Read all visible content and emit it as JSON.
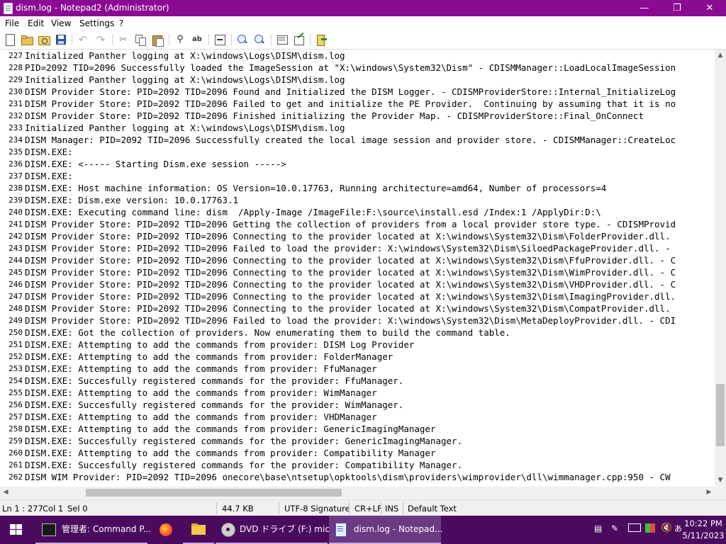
{
  "window": {
    "title": "dism.log - Notepad2 (Administrator)",
    "minimize": "—",
    "maximize": "❐",
    "close": "✕"
  },
  "menu": [
    "File",
    "Edit",
    "View",
    "Settings",
    "?"
  ],
  "editor": {
    "lines": [
      {
        "n": "227",
        "t": "Initialized Panther logging at X:\\windows\\Logs\\DISM\\dism.log"
      },
      {
        "n": "228",
        "t": "PID=2092 TID=2096 Successfully loaded the ImageSession at \"X:\\windows\\System32\\Dism\" - CDISMManager::LoadLocalImageSession"
      },
      {
        "n": "229",
        "t": "Initialized Panther logging at X:\\windows\\Logs\\DISM\\dism.log"
      },
      {
        "n": "230",
        "t": "DISM Provider Store: PID=2092 TID=2096 Found and Initialized the DISM Logger. - CDISMProviderStore::Internal_InitializeLog"
      },
      {
        "n": "231",
        "t": "DISM Provider Store: PID=2092 TID=2096 Failed to get and initialize the PE Provider.  Continuing by assuming that it is no"
      },
      {
        "n": "232",
        "t": "DISM Provider Store: PID=2092 TID=2096 Finished initializing the Provider Map. - CDISMProviderStore::Final_OnConnect"
      },
      {
        "n": "233",
        "t": "Initialized Panther logging at X:\\windows\\Logs\\DISM\\dism.log"
      },
      {
        "n": "234",
        "t": "DISM Manager: PID=2092 TID=2096 Successfully created the local image session and provider store. - CDISMManager::CreateLoc"
      },
      {
        "n": "235",
        "t": "DISM.EXE:"
      },
      {
        "n": "236",
        "t": "DISM.EXE: <----- Starting Dism.exe session ----->"
      },
      {
        "n": "237",
        "t": "DISM.EXE:"
      },
      {
        "n": "238",
        "t": "DISM.EXE: Host machine information: OS Version=10.0.17763, Running architecture=amd64, Number of processors=4"
      },
      {
        "n": "239",
        "t": "DISM.EXE: Dism.exe version: 10.0.17763.1"
      },
      {
        "n": "240",
        "t": "DISM.EXE: Executing command line: dism  /Apply-Image /ImageFile:F:\\source\\install.esd /Index:1 /ApplyDir:D:\\"
      },
      {
        "n": "241",
        "t": "DISM Provider Store: PID=2092 TID=2096 Getting the collection of providers from a local provider store type. - CDISMProvid"
      },
      {
        "n": "242",
        "t": "DISM Provider Store: PID=2092 TID=2096 Connecting to the provider located at X:\\windows\\System32\\Dism\\FolderProvider.dll."
      },
      {
        "n": "243",
        "t": "DISM Provider Store: PID=2092 TID=2096 Failed to load the provider: X:\\windows\\System32\\Dism\\SiloedPackageProvider.dll. -"
      },
      {
        "n": "244",
        "t": "DISM Provider Store: PID=2092 TID=2096 Connecting to the provider located at X:\\windows\\System32\\Dism\\FfuProvider.dll. - C"
      },
      {
        "n": "245",
        "t": "DISM Provider Store: PID=2092 TID=2096 Connecting to the provider located at X:\\windows\\System32\\Dism\\WimProvider.dll. - C"
      },
      {
        "n": "246",
        "t": "DISM Provider Store: PID=2092 TID=2096 Connecting to the provider located at X:\\windows\\System32\\Dism\\VHDProvider.dll. - C"
      },
      {
        "n": "247",
        "t": "DISM Provider Store: PID=2092 TID=2096 Connecting to the provider located at X:\\windows\\System32\\Dism\\ImagingProvider.dll."
      },
      {
        "n": "248",
        "t": "DISM Provider Store: PID=2092 TID=2096 Connecting to the provider located at X:\\windows\\System32\\Dism\\CompatProvider.dll."
      },
      {
        "n": "249",
        "t": "DISM Provider Store: PID=2092 TID=2096 Failed to load the provider: X:\\windows\\System32\\Dism\\MetaDeployProvider.dll. - CDI"
      },
      {
        "n": "250",
        "t": "DISM.EXE: Got the collection of providers. Now enumerating them to build the command table."
      },
      {
        "n": "251",
        "t": "DISM.EXE: Attempting to add the commands from provider: DISM Log Provider"
      },
      {
        "n": "252",
        "t": "DISM.EXE: Attempting to add the commands from provider: FolderManager"
      },
      {
        "n": "253",
        "t": "DISM.EXE: Attempting to add the commands from provider: FfuManager"
      },
      {
        "n": "254",
        "t": "DISM.EXE: Succesfully registered commands for the provider: FfuManager."
      },
      {
        "n": "255",
        "t": "DISM.EXE: Attempting to add the commands from provider: WimManager"
      },
      {
        "n": "256",
        "t": "DISM.EXE: Succesfully registered commands for the provider: WimManager."
      },
      {
        "n": "257",
        "t": "DISM.EXE: Attempting to add the commands from provider: VHDManager"
      },
      {
        "n": "258",
        "t": "DISM.EXE: Attempting to add the commands from provider: GenericImagingManager"
      },
      {
        "n": "259",
        "t": "DISM.EXE: Succesfully registered commands for the provider: GenericImagingManager."
      },
      {
        "n": "260",
        "t": "DISM.EXE: Attempting to add the commands from provider: Compatibility Manager"
      },
      {
        "n": "261",
        "t": "DISM.EXE: Succesfully registered commands for the provider: Compatibility Manager."
      },
      {
        "n": "262",
        "t": "DISM WIM Provider: PID=2092 TID=2096 onecore\\base\\ntsetup\\opktools\\dism\\providers\\wimprovider\\dll\\wimmanager.cpp:950 - CW"
      }
    ]
  },
  "scroll": {
    "vertical_position": 0.92,
    "vertical_thumb": 0.15,
    "horizontal_position": 0.17,
    "horizontal_thumb": 0.37
  },
  "status": {
    "position": "Ln 1 : 277",
    "col": "Col 1",
    "sel": "Sel 0",
    "size": "44.7 KB",
    "encoding": "UTF-8 Signature",
    "eol": "CR+LF",
    "mode": "INS",
    "scheme": "Default Text"
  },
  "taskbar": {
    "items": [
      {
        "label": "管理者: Command P...",
        "icon": "terminal-icon"
      },
      {
        "label": "",
        "icon": "firefox-icon"
      },
      {
        "label": "",
        "icon": "folder-icon"
      },
      {
        "label": "DVD ドライブ (F:) micr...",
        "icon": "dvd-icon"
      },
      {
        "label": "dism.log - Notepad...",
        "icon": "notepad-icon"
      }
    ],
    "clock_time": "10:22 PM",
    "clock_date": "5/11/2023"
  },
  "colors": {
    "titlebar": "#8a0b91",
    "taskbar": "#4a0b5e",
    "active_task": "#6c3a82"
  }
}
